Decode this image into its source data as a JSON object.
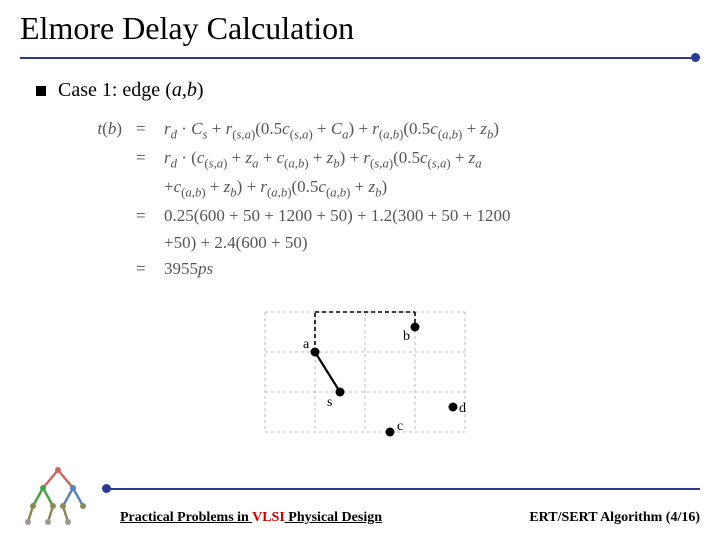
{
  "title": "Elmore Delay Calculation",
  "bullet": {
    "prefix": "Case 1: edge (",
    "var1": "a",
    "sep": ",",
    "var2": "b",
    "suffix": ")"
  },
  "math": {
    "lhs": "t(b)",
    "eq": "=",
    "line1": "r_d · C_s + r_(s,a)(0.5c_(s,a) + C_a) + r_(a,b)(0.5c_(a,b) + z_b)",
    "line2": "r_d · (c_(s,a) + z_a + c_(a,b) + z_b) + r_(s,a)(0.5c_(s,a) + z_a",
    "line2b": "+c_(a,b) + z_b) + r_(a,b)(0.5c_(a,b) + z_b)",
    "line3": "0.25(600 + 50 + 1200 + 50) + 1.2(300 + 50 + 1200",
    "line3b": "+50) + 2.4(600 + 50)",
    "line4": "3955ps"
  },
  "diagram": {
    "labels": {
      "a": "a",
      "b": "b",
      "s": "s",
      "c": "c",
      "d": "d"
    }
  },
  "footer": {
    "left_pp": "Practical Problems in ",
    "left_vlsi": "VLSI",
    "left_pd": " Physical Design",
    "right": "ERT/SERT Algorithm (4/16)"
  }
}
